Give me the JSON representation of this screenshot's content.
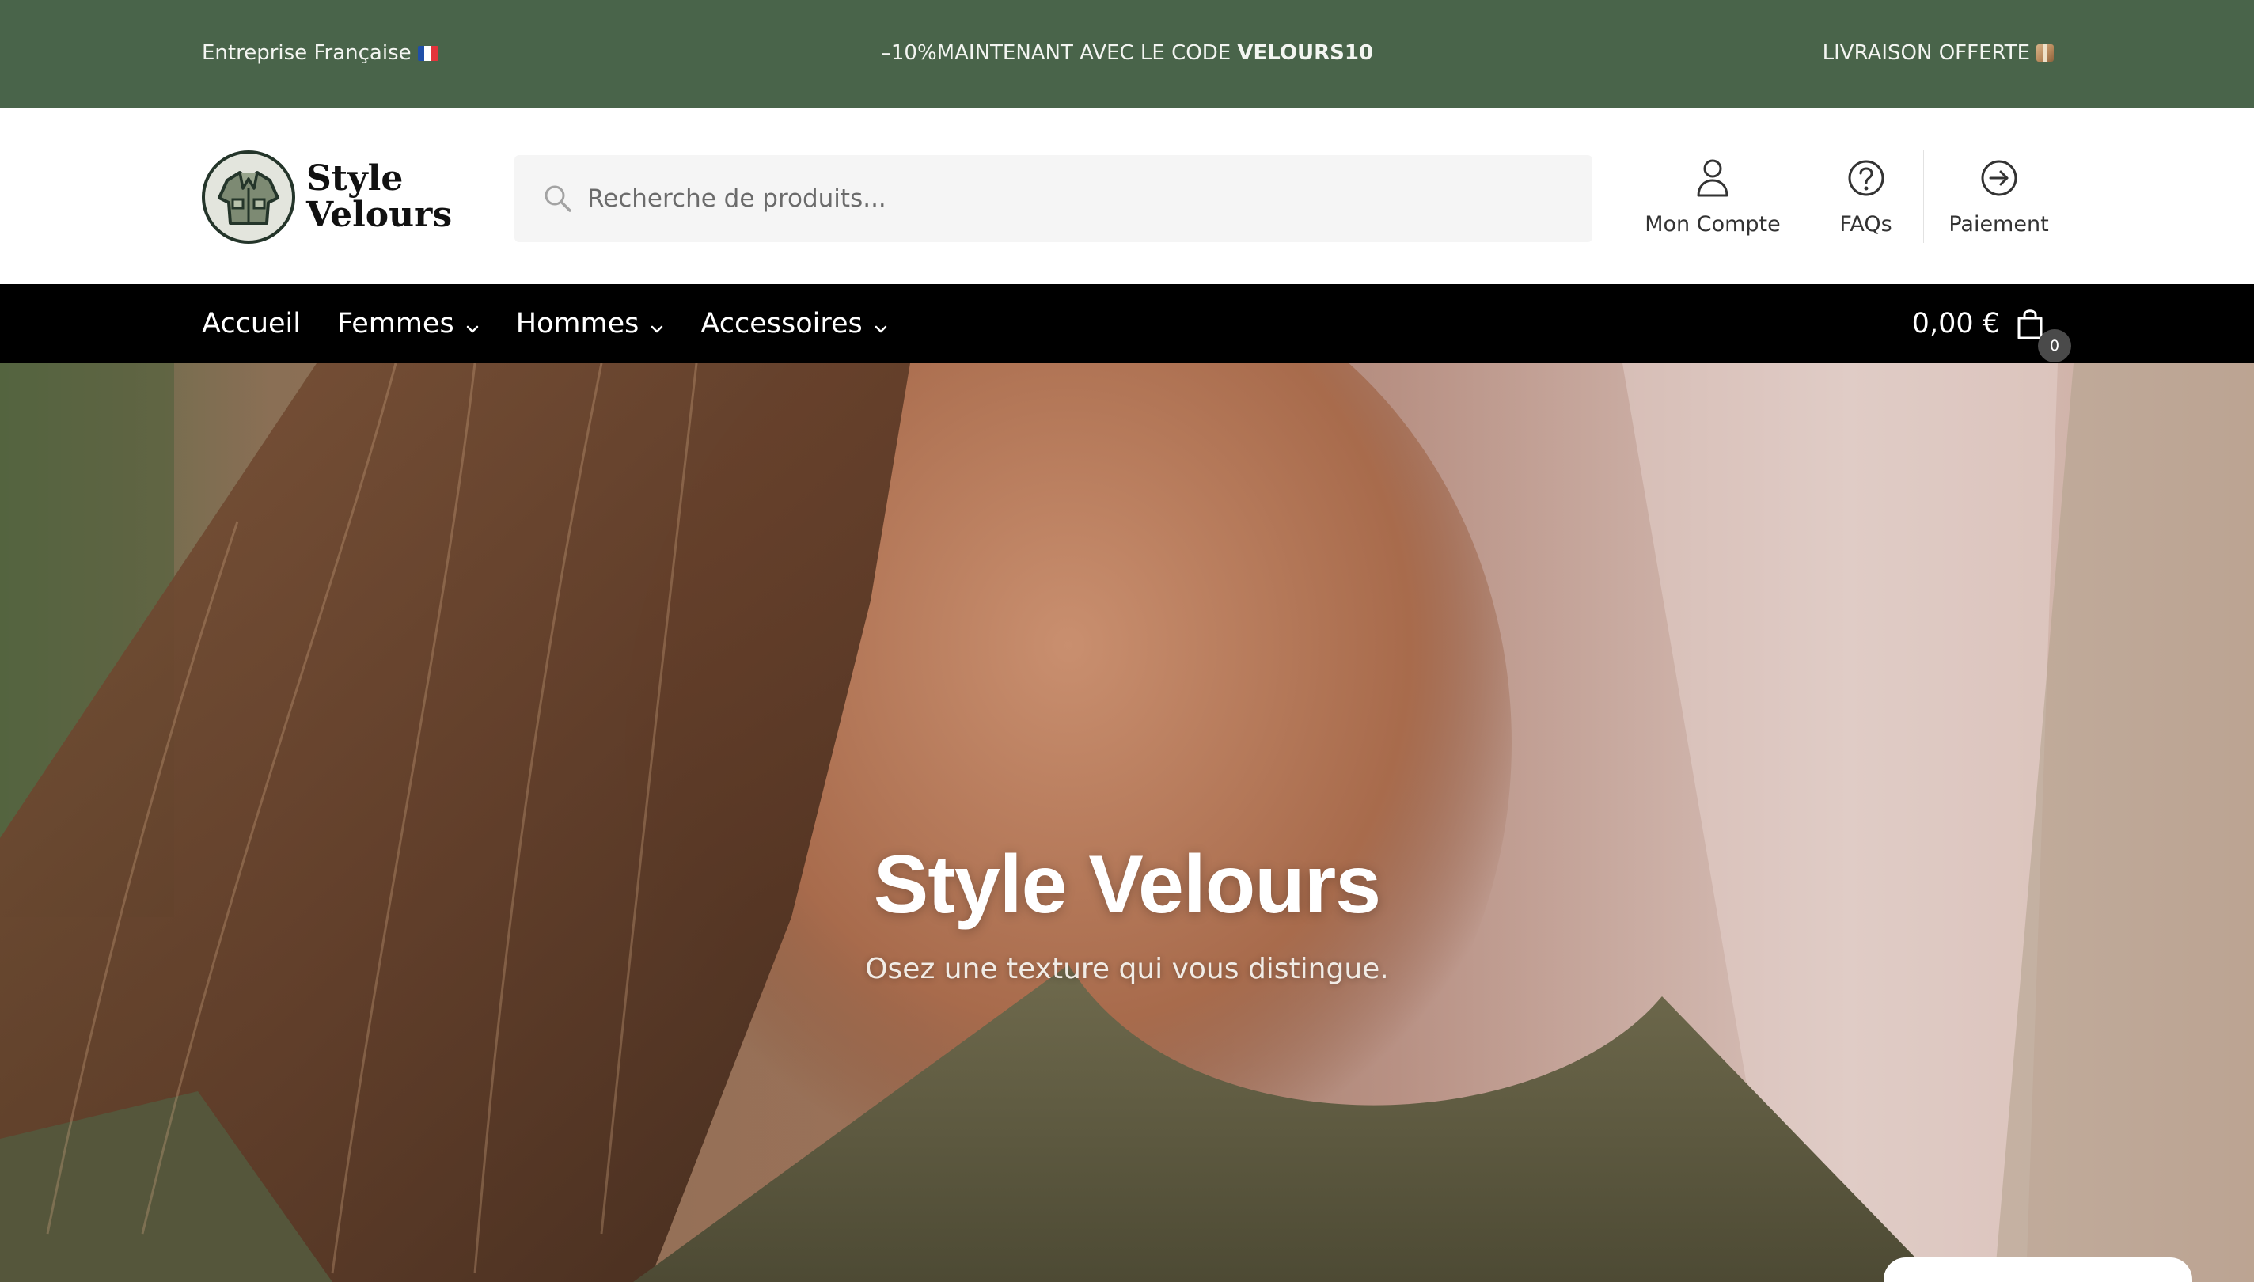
{
  "topbar": {
    "left_text": "Entreprise Française",
    "center_prefix": "–10%MAINTENANT AVEC LE CODE ",
    "center_code": "VELOURS10",
    "right_text": "LIVRAISON OFFERTE",
    "left_icon": "french-flag-icon",
    "right_icon": "package-icon"
  },
  "header": {
    "logo_line1": "Style",
    "logo_line2": "Velours",
    "search_placeholder": "Recherche de produits...",
    "links": {
      "account": "Mon Compte",
      "faqs": "FAQs",
      "checkout": "Paiement"
    }
  },
  "nav": {
    "items": [
      {
        "label": "Accueil",
        "dropdown": false
      },
      {
        "label": "Femmes",
        "dropdown": true
      },
      {
        "label": "Hommes",
        "dropdown": true
      },
      {
        "label": "Accessoires",
        "dropdown": true
      }
    ],
    "cart_total": "0,00 €",
    "cart_count": "0"
  },
  "hero": {
    "title": "Style Velours",
    "subtitle": "Osez une texture qui vous distingue."
  },
  "colors": {
    "topbar_bg": "#49644a",
    "nav_bg": "#000000",
    "search_bg": "#f5f5f5"
  }
}
